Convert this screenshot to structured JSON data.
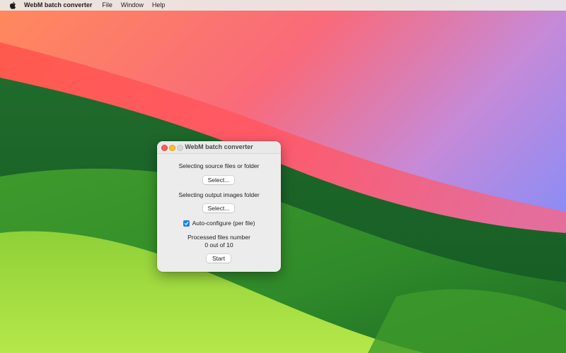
{
  "menubar": {
    "apple_icon": "apple-logo-icon",
    "app_name": "WebM batch converter",
    "items": [
      {
        "label": "File"
      },
      {
        "label": "Window"
      },
      {
        "label": "Help"
      }
    ]
  },
  "window": {
    "title": "WebM batch converter",
    "source_label": "Selecting source files or folder",
    "source_button": "Select...",
    "output_label": "Selecting output images folder",
    "output_button": "Select...",
    "auto_configure": {
      "label": "Auto-configure (per file)",
      "checked": true
    },
    "processed_label": "Processed files number",
    "processed_value": "0 out of 10",
    "start_button": "Start"
  },
  "colors": {
    "checkbox_accent": "#1e7ff5",
    "close_button": "#ff5f57",
    "minimize_button": "#febc2e",
    "zoom_button_inactive": "#d6d6d6"
  }
}
